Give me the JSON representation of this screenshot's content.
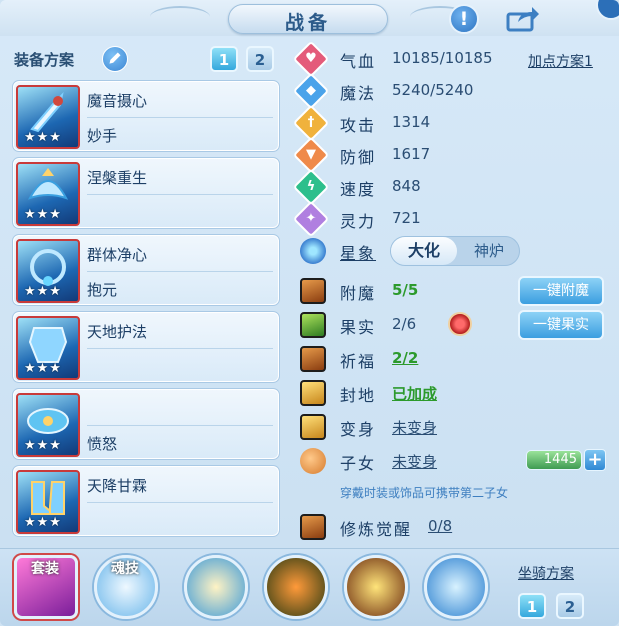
{
  "window": {
    "title": "战备"
  },
  "left": {
    "plan_label": "装备方案",
    "plans": [
      "1",
      "2"
    ],
    "equipment": [
      {
        "name": "魔音摄心",
        "sub": "妙手",
        "stars": "★★★"
      },
      {
        "name": "涅槃重生",
        "sub": "",
        "stars": "★★★"
      },
      {
        "name": "群体净心",
        "sub": "抱元",
        "stars": "★★★"
      },
      {
        "name": "天地护法",
        "sub": "",
        "stars": "★★★"
      },
      {
        "name": "",
        "sub": "愤怒",
        "stars": "★★★"
      },
      {
        "name": "天降甘霖",
        "sub": "",
        "stars": "★★★"
      }
    ]
  },
  "stats": {
    "add_point_plan": "加点方案1",
    "items": [
      {
        "name": "气血",
        "value": "10185/10185",
        "icon": "heart-icon",
        "color": "#e45b7a"
      },
      {
        "name": "魔法",
        "value": "5240/5240",
        "icon": "shield-icon",
        "color": "#4aa3ea"
      },
      {
        "name": "攻击",
        "value": "1314",
        "icon": "sword-icon",
        "color": "#f0b23c"
      },
      {
        "name": "防御",
        "value": "1617",
        "icon": "armor-icon",
        "color": "#ef8a4a"
      },
      {
        "name": "速度",
        "value": "848",
        "icon": "lightning-icon",
        "color": "#2dbf8c"
      },
      {
        "name": "灵力",
        "value": "721",
        "icon": "sparkle-icon",
        "color": "#b07fe0"
      }
    ]
  },
  "xingxiang": {
    "label": "星象",
    "options": [
      "大化",
      "神炉"
    ],
    "selected": "大化"
  },
  "enhance": {
    "fumo": {
      "label": "附魔",
      "value": "5/5",
      "button": "一键附魔"
    },
    "guoshi": {
      "label": "果实",
      "value": "2/6",
      "button": "一键果实"
    },
    "qifu": {
      "label": "祈福",
      "value": "2/2"
    },
    "fengdi": {
      "label": "封地",
      "value": "已加成"
    },
    "bianshen": {
      "label": "变身",
      "value": "未变身"
    },
    "zinv": {
      "label": "子女",
      "value": "未变身",
      "bar_value": "1445",
      "plus": "+"
    },
    "tip": "穿戴时装或饰品可携带第二子女",
    "xiulian": {
      "label": "修炼觉醒",
      "value": "0/8"
    }
  },
  "bottom": {
    "taozhuang": "套装",
    "hunji": "魂技",
    "mount_plan": "坐骑方案",
    "mount_plans": [
      "1",
      "2"
    ]
  }
}
